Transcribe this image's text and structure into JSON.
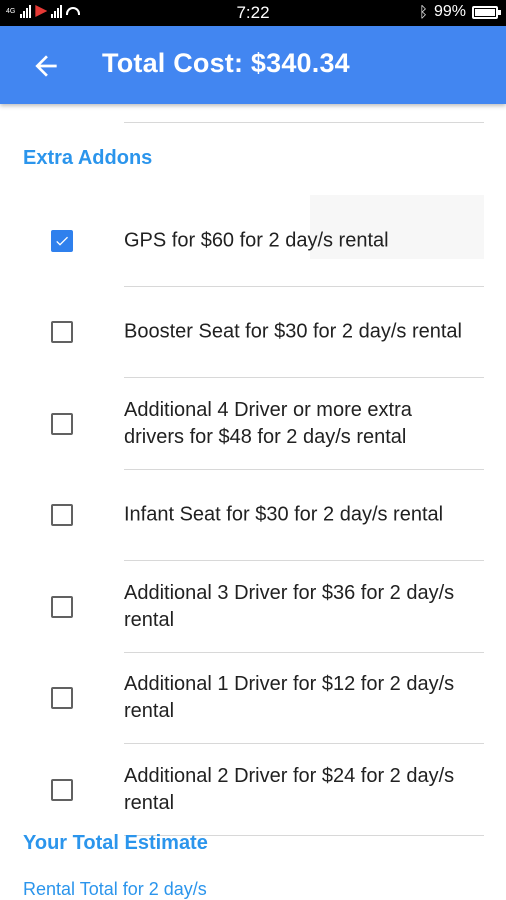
{
  "status_bar": {
    "network_left": "4G",
    "time": "7:22",
    "battery": "99%",
    "battery_level": 0.99,
    "icons": [
      "signal-icon",
      "app-notification-icon",
      "wifi-signal-icon",
      "hotspot-icon",
      "bluetooth-icon",
      "battery-icon"
    ]
  },
  "app_bar": {
    "title": "Total Cost: $340.34",
    "back_icon": "arrow-back-icon",
    "color": "#4286f1"
  },
  "extra_addons": {
    "title": "Extra Addons",
    "items": [
      {
        "label": "GPS for $60 for 2 day/s rental",
        "checked": true
      },
      {
        "label": "Booster Seat for $30 for 2 day/s rental",
        "checked": false
      },
      {
        "label": "Additional 4 Driver or more extra drivers for $48 for 2 day/s rental",
        "checked": false
      },
      {
        "label": "Infant Seat for $30 for 2 day/s rental",
        "checked": false
      },
      {
        "label": "Additional 3 Driver for $36 for 2 day/s rental",
        "checked": false
      },
      {
        "label": "Additional 1 Driver for $12 for 2 day/s rental",
        "checked": false
      },
      {
        "label": "Additional 2 Driver for $24 for 2 day/s rental",
        "checked": false
      }
    ]
  },
  "estimate": {
    "title": "Your Total Estimate",
    "rental_total_label": "Rental Total for 2 day/s"
  },
  "colors": {
    "accent": "#2b95ec",
    "checkbox_checked": "#2f80ed",
    "text": "#212121"
  }
}
